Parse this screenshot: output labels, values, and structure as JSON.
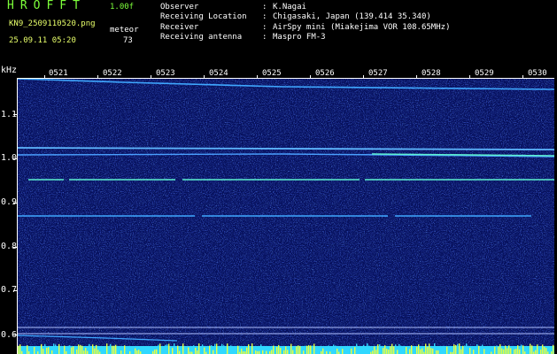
{
  "app": {
    "title": "HROFFT",
    "version": "1.00f"
  },
  "file": {
    "name": "KN9_2509110520.png",
    "datetime": "25.09.11 05:20"
  },
  "meteor": {
    "label": "meteor",
    "count": "73"
  },
  "meta": [
    {
      "key": "Observer",
      "value": "K.Nagai"
    },
    {
      "key": "Receiving Location",
      "value": "Chigasaki, Japan (139.414 35.340)"
    },
    {
      "key": "Receiver",
      "value": "AirSpy mini (Miakejima VOR 108.65MHz)"
    },
    {
      "key": "Receiving antenna",
      "value": "Maspro FM-3"
    }
  ],
  "colon": ":",
  "y_axis": {
    "unit": "kHz",
    "labels": [
      "1.1",
      "1.0",
      "0.9",
      "0.8",
      "0.7",
      "0.6"
    ]
  },
  "x_axis": {
    "labels": [
      "0521",
      "0522",
      "0523",
      "0524",
      "0525",
      "0526",
      "0527",
      "0528",
      "0529",
      "0530"
    ]
  },
  "colors": {
    "background": "#081070",
    "carrier": "#3fa8ff",
    "bright": "#5df0d0",
    "noise_floor": "#e8ff40"
  }
}
